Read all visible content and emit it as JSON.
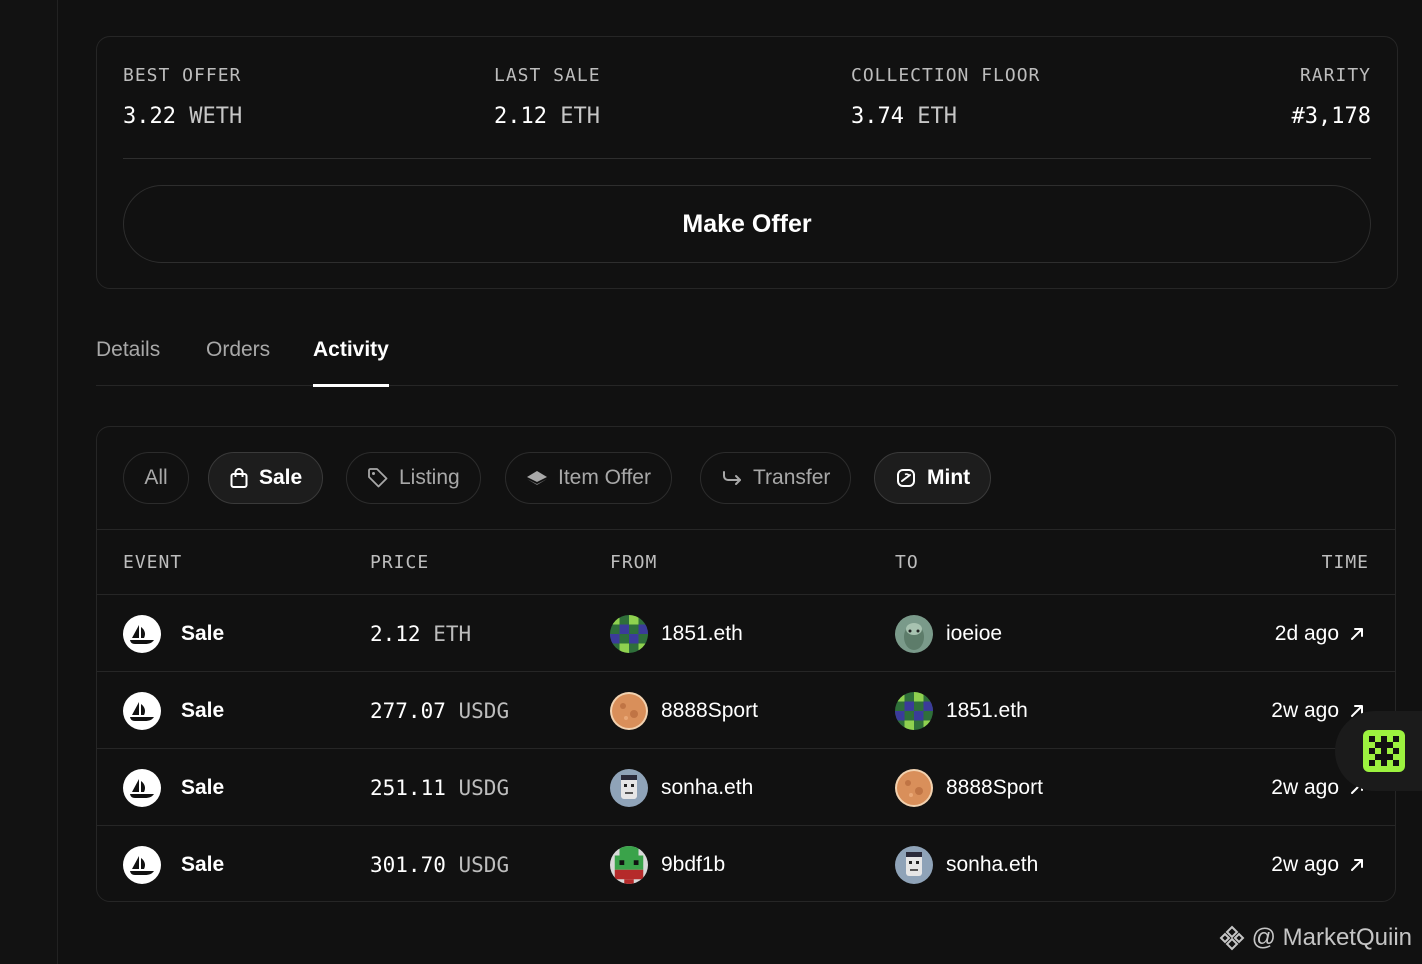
{
  "stats": {
    "best_offer": {
      "label": "BEST OFFER",
      "amount": "3.22",
      "unit": "WETH"
    },
    "last_sale": {
      "label": "LAST SALE",
      "amount": "2.12",
      "unit": "ETH"
    },
    "collection_floor": {
      "label": "COLLECTION FLOOR",
      "amount": "3.74",
      "unit": "ETH"
    },
    "rarity": {
      "label": "RARITY",
      "value": "#3,178"
    }
  },
  "make_offer_label": "Make Offer",
  "tabs": [
    {
      "label": "Details",
      "active": false
    },
    {
      "label": "Orders",
      "active": false
    },
    {
      "label": "Activity",
      "active": true
    }
  ],
  "filters": [
    {
      "label": "All",
      "icon": "none",
      "selected": false
    },
    {
      "label": "Sale",
      "icon": "shopping-bag-icon",
      "selected": true
    },
    {
      "label": "Listing",
      "icon": "tag-icon",
      "selected": false
    },
    {
      "label": "Item Offer",
      "icon": "ethereum-icon",
      "selected": false
    },
    {
      "label": "Transfer",
      "icon": "transfer-arrow-icon",
      "selected": false
    },
    {
      "label": "Mint",
      "icon": "mint-icon",
      "selected": true
    }
  ],
  "table": {
    "headers": {
      "event": "EVENT",
      "price": "PRICE",
      "from": "FROM",
      "to": "TO",
      "time": "TIME"
    },
    "rows": [
      {
        "event": "Sale",
        "amount": "2.12",
        "unit": "ETH",
        "from": "1851.eth",
        "to": "ioeioe",
        "time": "2d ago"
      },
      {
        "event": "Sale",
        "amount": "277.07",
        "unit": "USDG",
        "from": "8888Sport",
        "to": "1851.eth",
        "time": "2w ago"
      },
      {
        "event": "Sale",
        "amount": "251.11",
        "unit": "USDG",
        "from": "sonha.eth",
        "to": "8888Sport",
        "time": "2w ago"
      },
      {
        "event": "Sale",
        "amount": "301.70",
        "unit": "USDG",
        "from": "9bdf1b",
        "to": "sonha.eth",
        "time": "2w ago"
      }
    ]
  },
  "watermark": "@ MarketQuiin",
  "colors": {
    "background": "#111111",
    "accent": "#9cf23f"
  }
}
